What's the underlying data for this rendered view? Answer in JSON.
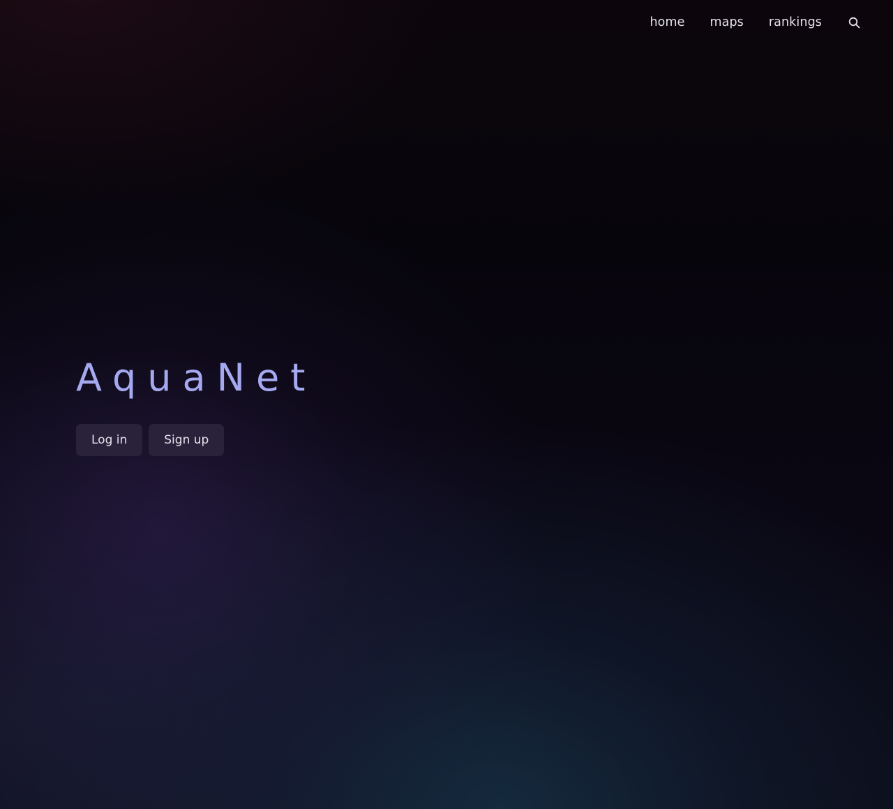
{
  "nav": {
    "links": [
      {
        "label": "home"
      },
      {
        "label": "maps"
      },
      {
        "label": "rankings"
      }
    ],
    "search_icon": "search-icon"
  },
  "hero": {
    "title": "AquaNet",
    "login_label": "Log in",
    "signup_label": "Sign up"
  },
  "colors": {
    "title": "#a5a9f0",
    "button_bg": "#29223a",
    "nav_text": "#e4e2ec"
  }
}
